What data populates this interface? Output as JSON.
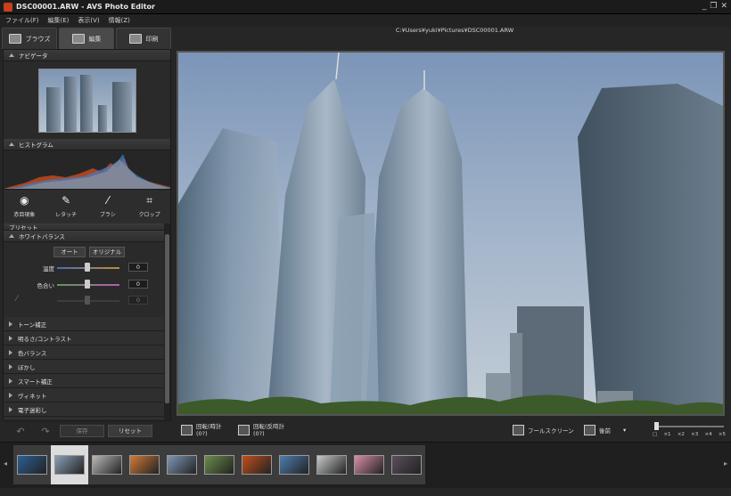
{
  "window": {
    "title": "DSC00001.ARW - AVS Photo Editor",
    "controls": [
      "_",
      "❐",
      "✕"
    ]
  },
  "menu": [
    "ファイル(F)",
    "編集(E)",
    "表示(V)",
    "情報(Z)"
  ],
  "tabs": [
    {
      "label": "ブラウズ",
      "icon": "folder-icon"
    },
    {
      "label": "編集",
      "icon": "edit-icon"
    },
    {
      "label": "印刷",
      "icon": "printer-icon"
    }
  ],
  "file_path": "C:¥Users¥yuki¥Pictures¥DSC00001.ARW",
  "panels": {
    "navigator": "ナビゲータ",
    "histogram": "ヒストグラム",
    "tools": [
      {
        "label": "赤目現象",
        "icon": "eye-icon"
      },
      {
        "label": "レタッチ",
        "icon": "retouch-icon"
      },
      {
        "label": "ブラシ",
        "icon": "brush-icon"
      },
      {
        "label": "クロップ",
        "icon": "crop-icon"
      }
    ],
    "preset": "プリセット",
    "white_balance": {
      "title": "ホワイトバランス",
      "auto_button": "オート",
      "original_button": "オリジナル",
      "sliders": [
        {
          "label": "温度",
          "value": "0"
        },
        {
          "label": "色合い",
          "value": "0"
        },
        {
          "label": "",
          "value": "0"
        }
      ]
    },
    "collapsed_sections": [
      "トーン補正",
      "明るさ/コントラスト",
      "色バランス",
      "ぼかし",
      "スマート補正",
      "ヴィネット",
      "電子迷彩し"
    ]
  },
  "left_bottom": {
    "save": "保存",
    "reset": "リセット"
  },
  "photo_toolbar": {
    "rotate_cw": [
      "回転(時計",
      "(0?)"
    ],
    "rotate_ccw": [
      "回転(反時計",
      "(0?)"
    ],
    "fullscreen": "フールスクリーン",
    "compare": "後前",
    "zoom_labels": [
      "□",
      "×1",
      "×2",
      "×3",
      "×4",
      "×5"
    ],
    "zoom_level": 0
  },
  "filmstrip": {
    "count": 11,
    "selected_index": 1,
    "thumb_colors": [
      "#2a5f95",
      "#8aa0b6",
      "#b9b9b9",
      "#d17a3a",
      "#7f97b5",
      "#6a8d4a",
      "#c24e1c",
      "#4d7db0",
      "#c7c9cb",
      "#d98fa6",
      "#5b4f5c"
    ]
  }
}
